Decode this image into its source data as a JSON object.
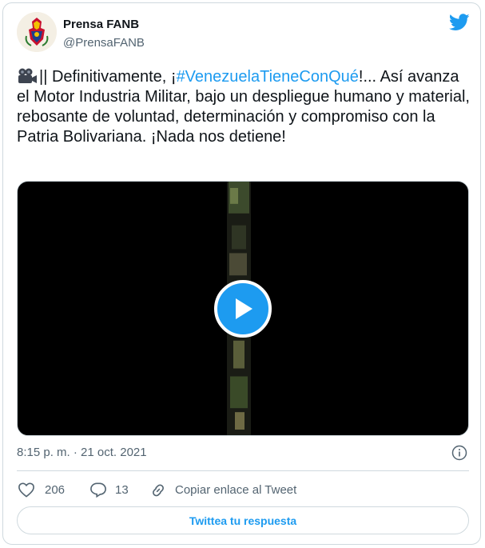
{
  "author": {
    "name": "Prensa FANB",
    "handle": "@PrensaFANB",
    "avatar_icon": "fanb-emblem-icon"
  },
  "tweet": {
    "text_before": "|| Definitivamente, ¡",
    "hashtag": "#VenezuelaTieneConQué",
    "text_after": "!... Así avanza el Motor Industria Militar, bajo un despliegue humano y material, rebosante de voluntad, determinación y compromiso con la Patria Bolivariana. ¡Nada nos detiene!",
    "leading_icon": "movie-camera-icon"
  },
  "media": {
    "type": "video",
    "play_icon": "play-icon"
  },
  "timestamp": "8:15 p. m. · 21 oct. 2021",
  "actions": {
    "like_count": "206",
    "reply_count": "13",
    "copy_link_label": "Copiar enlace al Tweet"
  },
  "reply_button_label": "Twittea tu respuesta",
  "colors": {
    "accent": "#1d9bf0",
    "text": "#0f1419",
    "muted": "#536471",
    "border": "#cfd9de"
  }
}
